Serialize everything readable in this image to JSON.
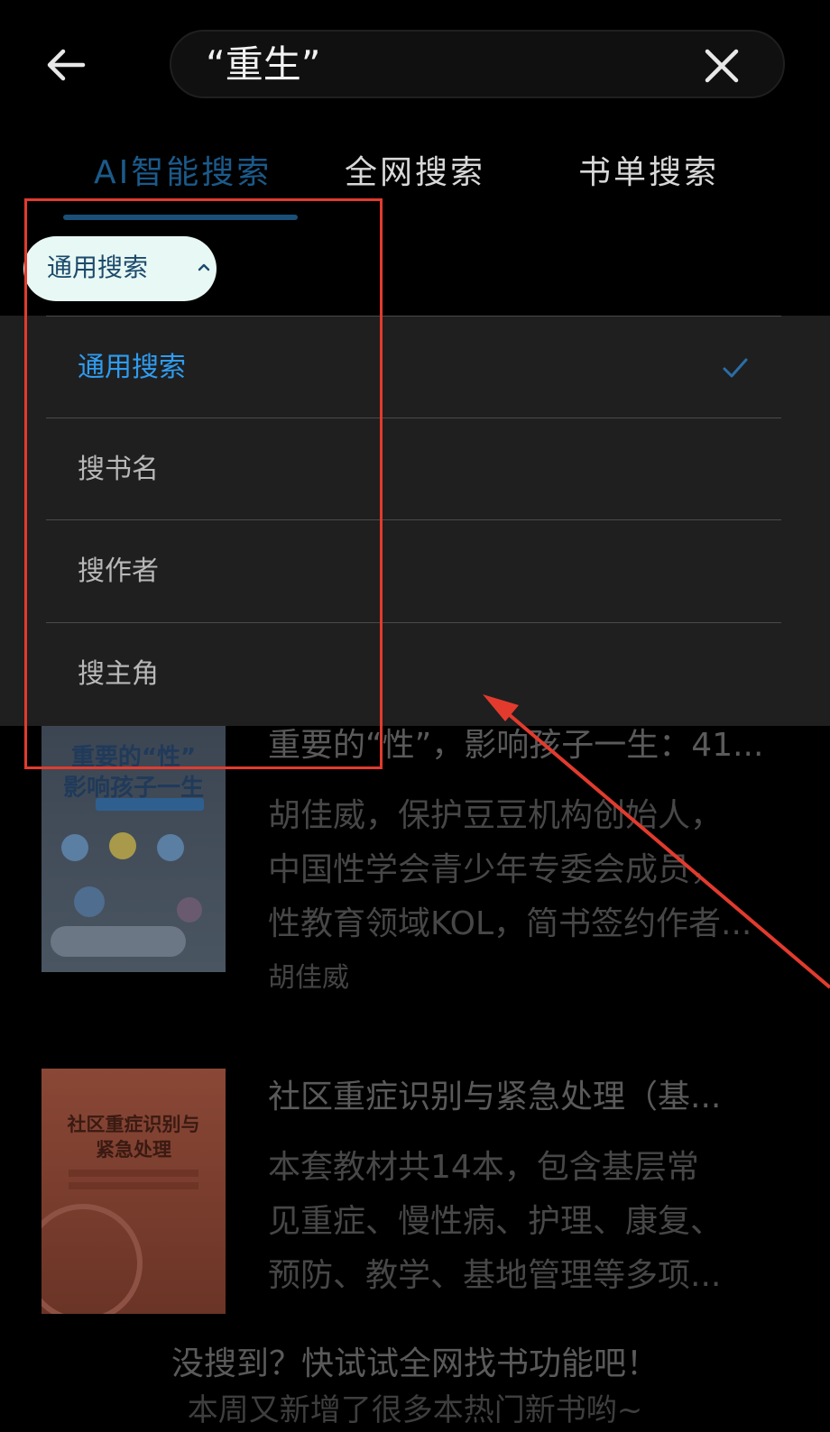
{
  "search": {
    "query": "“重生”"
  },
  "tabs": [
    {
      "label": "AI智能搜索",
      "active": true
    },
    {
      "label": "全网搜索",
      "active": false
    },
    {
      "label": "书单搜索",
      "active": false
    }
  ],
  "filter": {
    "label": "通用搜索"
  },
  "dropdown": {
    "options": [
      {
        "label": "通用搜索",
        "selected": true
      },
      {
        "label": "搜书名",
        "selected": false
      },
      {
        "label": "搜作者",
        "selected": false
      },
      {
        "label": "搜主角",
        "selected": false
      }
    ]
  },
  "books": [
    {
      "cover_title_line1": "重要的“性”",
      "cover_title_line2": "影响孩子一生",
      "title": "重要的“性”，影响孩子一生：41...",
      "desc_lines": [
        "胡佳威，保护豆豆机构创始人，",
        "中国性学会青少年专委会成员，",
        "性教育领域KOL，简书签约作者..."
      ],
      "author": "胡佳威"
    },
    {
      "cover_title_line1": "社区重症识别与",
      "cover_title_line2": "紧急处理",
      "title": "社区重症识别与紧急处理（基...",
      "desc_lines": [
        "本套教材共14本，包含基层常",
        "见重症、慢性病、护理、康复、",
        "预防、教学、基地管理等多项..."
      ]
    }
  ],
  "footer": {
    "line1": "没搜到？快试试全网找书功能吧！",
    "line2": "本周又新增了很多本热门新书哟~"
  },
  "colors": {
    "accent_blue": "#2f9cf0",
    "active_tab": "#1b5a8a",
    "annotation_red": "#e23b2e"
  }
}
